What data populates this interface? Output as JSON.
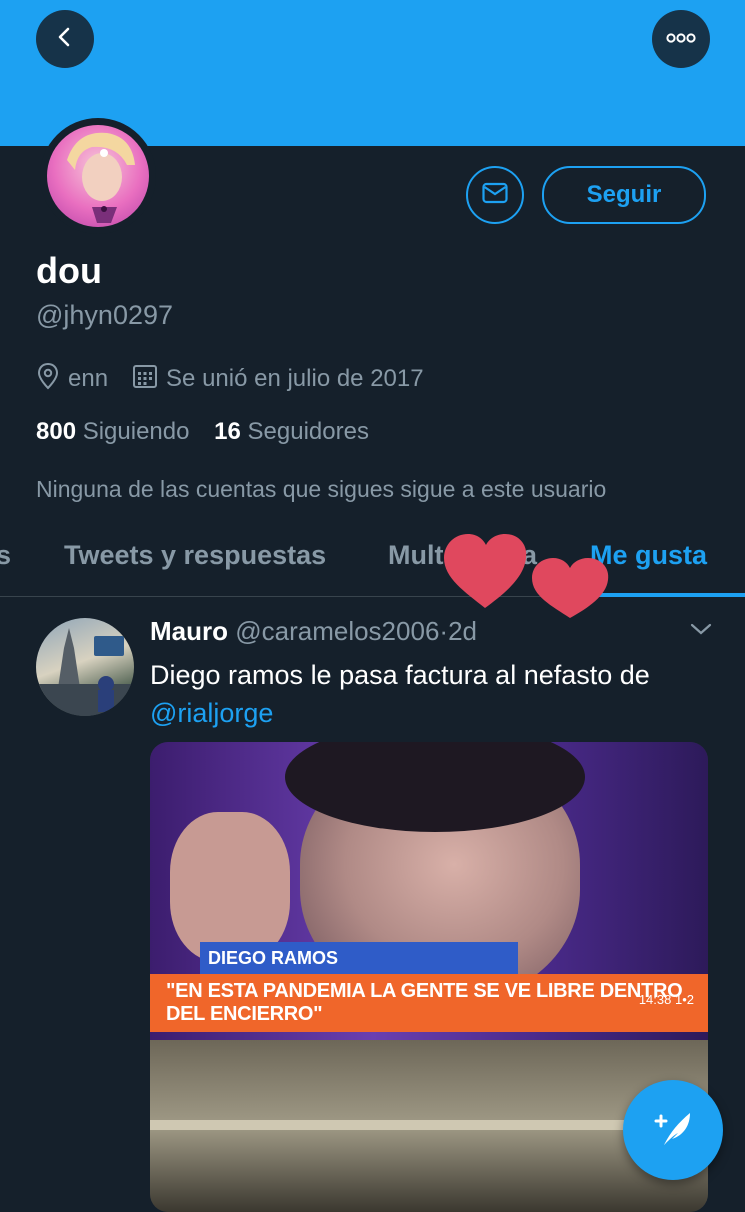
{
  "profile": {
    "name": "dou",
    "handle": "@jhyn0297",
    "location": "enn",
    "joined": "Se unió en julio de 2017",
    "following_count": "800",
    "following_label": "Siguiendo",
    "followers_count": "16",
    "followers_label": "Seguidores",
    "mutual_note": "Ninguna de las cuentas que sigues sigue a este usuario"
  },
  "actions": {
    "follow_label": "Seguir"
  },
  "tabs": [
    {
      "label": "s"
    },
    {
      "label": "Tweets y respuestas"
    },
    {
      "label": "Mult"
    },
    {
      "label": "a"
    },
    {
      "label": "Me gusta",
      "active": true
    }
  ],
  "tweet": {
    "author": "Mauro",
    "handle": "@caramelos2006",
    "separator": "·",
    "time": "2d",
    "text": "Diego ramos le pasa factura al nefasto de",
    "mention": "@rialjorge",
    "media": {
      "lower_third_name": "DIEGO RAMOS",
      "lower_third_quote": "\"EN ESTA PANDEMIA LA GENTE SE VE LIBRE DENTRO DEL ENCIERRO\"",
      "clock": "14:38",
      "channel": "1•2"
    }
  },
  "icons": {
    "back": "chevron-left-icon",
    "more": "more-dots-icon",
    "mail": "mail-icon",
    "location": "location-pin-icon",
    "calendar": "calendar-icon",
    "caret": "chevron-down-icon",
    "compose": "compose-feather-icon",
    "stickers": "heart-stickers"
  },
  "colors": {
    "accent": "#1da1f2",
    "background": "#15202b",
    "muted": "#8899a6",
    "heart": "#e0485e"
  }
}
